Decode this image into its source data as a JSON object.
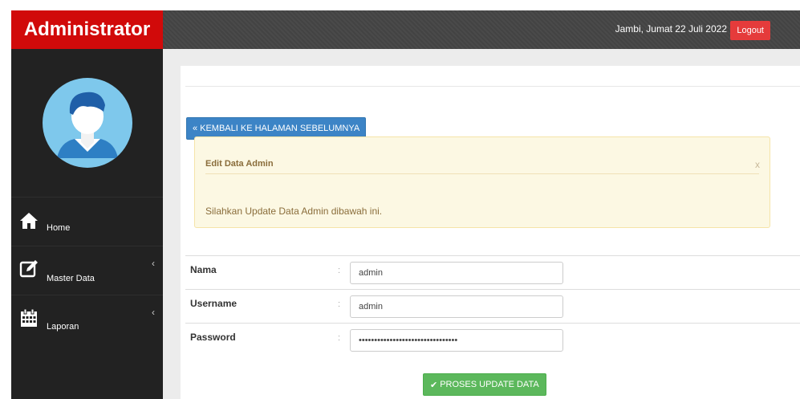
{
  "app": {
    "brand": "Administrator"
  },
  "header": {
    "date": "Jambi, Jumat 22 Juli 2022",
    "logout_label": "Logout"
  },
  "sidebar": {
    "items": [
      {
        "label": "Home",
        "icon": "home-icon",
        "has_submenu": false
      },
      {
        "label": "Master Data",
        "icon": "edit-icon",
        "has_submenu": true
      },
      {
        "label": "Laporan",
        "icon": "calendar-icon",
        "has_submenu": true
      }
    ]
  },
  "page": {
    "back_label": "KEMBALI KE HALAMAN SEBELUMNYA",
    "alert": {
      "title": "Edit Data Admin",
      "close": "x",
      "message": "Silahkan Update Data Admin dibawah ini."
    },
    "form": {
      "colon": ":",
      "fields": [
        {
          "label": "Nama",
          "value": "admin",
          "type": "text"
        },
        {
          "label": "Username",
          "value": "admin",
          "type": "text"
        },
        {
          "label": "Password",
          "value": "••••••••••••••••••••••••••••••••",
          "type": "password"
        }
      ],
      "submit_label": "PROSES UPDATE DATA"
    }
  },
  "colors": {
    "brand": "#d10a0a",
    "topbar": "#474747",
    "sidebar": "#222222",
    "logout": "#e53b3b",
    "primary": "#3c84c6",
    "success": "#5cb85c",
    "alert_bg": "#fcf8e3"
  }
}
